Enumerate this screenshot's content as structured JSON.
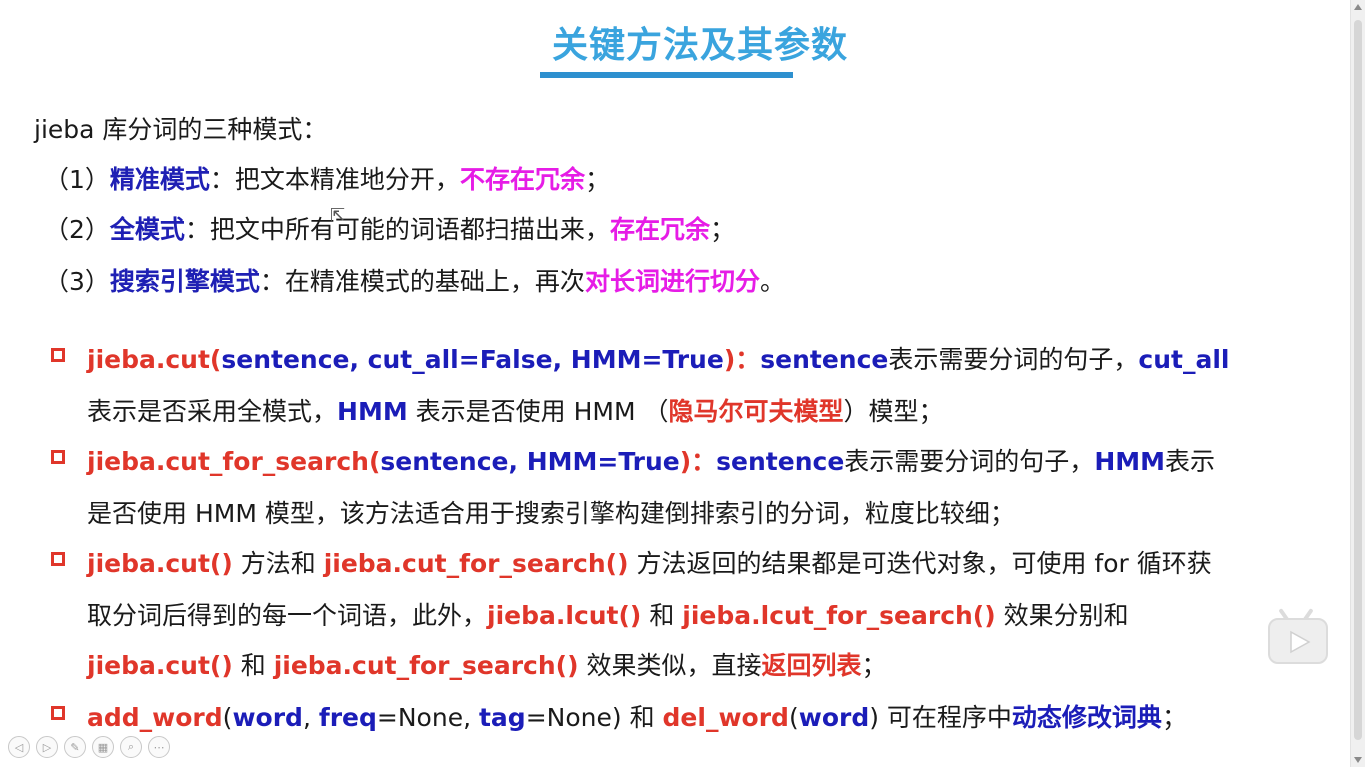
{
  "slide": {
    "title": "关键方法及其参数",
    "intro": "jieba 库分词的三种模式：",
    "modes": [
      {
        "num": "（1）",
        "name": "精准模式",
        "desc": "：把文本精准地分开，",
        "highlight": "不存在冗余",
        "end": "；"
      },
      {
        "num": "（2）",
        "name": "全模式",
        "desc": "：把文中所有可能的词语都扫描出来，",
        "highlight": "存在冗余",
        "end": "；"
      },
      {
        "num": "（3）",
        "name": "搜索引擎模式",
        "desc": "：在精准模式的基础上，再次",
        "highlight": "对长词进行切分",
        "end": "。"
      }
    ],
    "bullet1": {
      "func": "jieba.cut(",
      "args": "sentence, cut_all=False, HMM=True",
      "close": ")：",
      "p1": "sentence",
      "t1": "表示需要分词的句子，",
      "p2": "cut_all",
      "t2": "表示是否采用全模式，",
      "p3": "HMM",
      "t3": " 表示是否使用 HMM （",
      "hl": "隐马尔可夫模型",
      "t4": "）模型；"
    },
    "bullet2": {
      "func": "jieba.cut_for_search(",
      "args": "sentence, HMM=True",
      "close": ")：",
      "p1": "sentence",
      "t1": "表示需要分词的句子，",
      "p2": "HMM",
      "t2": "表示",
      "t3": "是否使用 HMM 模型，该方法适合用于搜索引擎构建倒排索引的分词，粒度比较细；"
    },
    "bullet3": {
      "f1": "jieba.cut()",
      "t1": " 方法和 ",
      "f2": "jieba.cut_for_search()",
      "t2": " 方法返回的结果都是可迭代对象，可使用 for 循环获",
      "t3": "取分词后得到的每一个词语，此外，",
      "f3": "jieba.lcut()",
      "t4": " 和 ",
      "f4": "jieba.lcut_for_search()",
      "t5": " 效果分别和",
      "f5": "jieba.cut()",
      "t6": " 和 ",
      "f6": "jieba.cut_for_search()",
      "t7": " 效果类似，直接",
      "hl": "返回列表",
      "t8": "；"
    },
    "bullet4": {
      "f1": "add_word",
      "o1": "(",
      "a1": "word",
      "c1": ", ",
      "a2": "freq",
      "t1": "=None, ",
      "a3": "tag",
      "t2": "=None) 和 ",
      "f2": "del_word",
      "o2": "(",
      "a4": "word",
      "t3": ") 可在程序中",
      "hl": "动态修改词典",
      "t4": "；"
    }
  },
  "toolbar": {
    "icons": [
      "prev-icon",
      "next-icon",
      "pen-icon",
      "slides-icon",
      "zoom-icon",
      "more-icon"
    ],
    "glyphs": [
      "◁",
      "▷",
      "✎",
      "▦",
      "⌕",
      "⋯"
    ]
  },
  "colors": {
    "title": "#3aa4de",
    "mode_name": "#1f20b4",
    "highlight_magenta": "#e61ce6",
    "function_red": "#e0362a",
    "param_blue": "#1b1db8"
  }
}
